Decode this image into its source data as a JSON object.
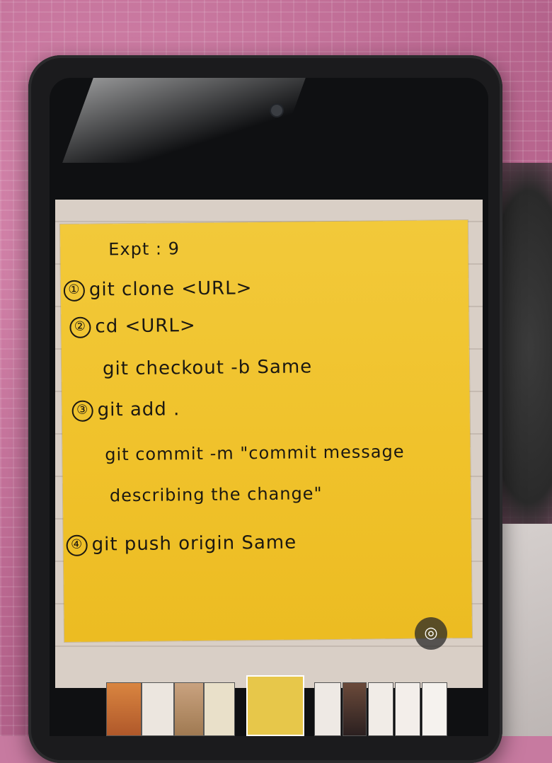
{
  "note": {
    "title": "Expt : 9",
    "steps": [
      {
        "marker": "①",
        "text": "git clone <URL>"
      },
      {
        "marker": "②",
        "text": "cd <URL>"
      },
      {
        "marker": "",
        "text": "git checkout -b Same"
      },
      {
        "marker": "③",
        "text": "git add ."
      },
      {
        "marker": "",
        "text": "git commit -m \"commit message"
      },
      {
        "marker": "",
        "text": "describing the change\""
      },
      {
        "marker": "④",
        "text": "git push origin Same"
      }
    ]
  },
  "icons": {
    "lens": "lens-icon",
    "lens_glyph": "◎"
  },
  "colors": {
    "note_yellow": "#f0c22b",
    "ink": "#1b1812",
    "phone_body": "#1b1b1d",
    "cloth_pink": "#c77aa0"
  }
}
